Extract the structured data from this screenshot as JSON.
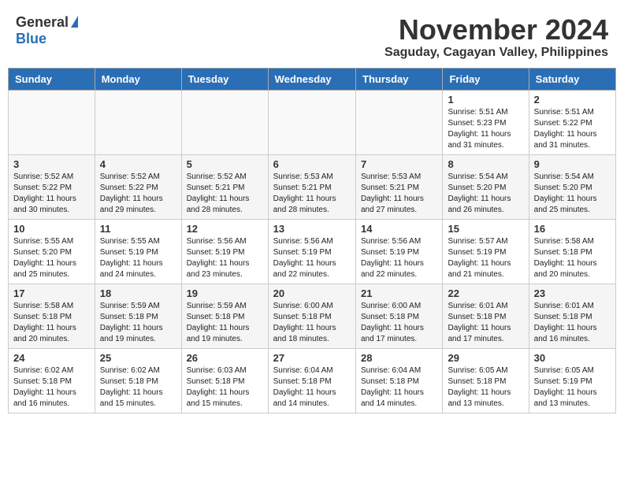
{
  "header": {
    "logo_general": "General",
    "logo_blue": "Blue",
    "month_title": "November 2024",
    "location": "Saguday, Cagayan Valley, Philippines"
  },
  "days_of_week": [
    "Sunday",
    "Monday",
    "Tuesday",
    "Wednesday",
    "Thursday",
    "Friday",
    "Saturday"
  ],
  "weeks": [
    [
      {
        "day": "",
        "info": ""
      },
      {
        "day": "",
        "info": ""
      },
      {
        "day": "",
        "info": ""
      },
      {
        "day": "",
        "info": ""
      },
      {
        "day": "",
        "info": ""
      },
      {
        "day": "1",
        "info": "Sunrise: 5:51 AM\nSunset: 5:23 PM\nDaylight: 11 hours and 31 minutes."
      },
      {
        "day": "2",
        "info": "Sunrise: 5:51 AM\nSunset: 5:22 PM\nDaylight: 11 hours and 31 minutes."
      }
    ],
    [
      {
        "day": "3",
        "info": "Sunrise: 5:52 AM\nSunset: 5:22 PM\nDaylight: 11 hours and 30 minutes."
      },
      {
        "day": "4",
        "info": "Sunrise: 5:52 AM\nSunset: 5:22 PM\nDaylight: 11 hours and 29 minutes."
      },
      {
        "day": "5",
        "info": "Sunrise: 5:52 AM\nSunset: 5:21 PM\nDaylight: 11 hours and 28 minutes."
      },
      {
        "day": "6",
        "info": "Sunrise: 5:53 AM\nSunset: 5:21 PM\nDaylight: 11 hours and 28 minutes."
      },
      {
        "day": "7",
        "info": "Sunrise: 5:53 AM\nSunset: 5:21 PM\nDaylight: 11 hours and 27 minutes."
      },
      {
        "day": "8",
        "info": "Sunrise: 5:54 AM\nSunset: 5:20 PM\nDaylight: 11 hours and 26 minutes."
      },
      {
        "day": "9",
        "info": "Sunrise: 5:54 AM\nSunset: 5:20 PM\nDaylight: 11 hours and 25 minutes."
      }
    ],
    [
      {
        "day": "10",
        "info": "Sunrise: 5:55 AM\nSunset: 5:20 PM\nDaylight: 11 hours and 25 minutes."
      },
      {
        "day": "11",
        "info": "Sunrise: 5:55 AM\nSunset: 5:19 PM\nDaylight: 11 hours and 24 minutes."
      },
      {
        "day": "12",
        "info": "Sunrise: 5:56 AM\nSunset: 5:19 PM\nDaylight: 11 hours and 23 minutes."
      },
      {
        "day": "13",
        "info": "Sunrise: 5:56 AM\nSunset: 5:19 PM\nDaylight: 11 hours and 22 minutes."
      },
      {
        "day": "14",
        "info": "Sunrise: 5:56 AM\nSunset: 5:19 PM\nDaylight: 11 hours and 22 minutes."
      },
      {
        "day": "15",
        "info": "Sunrise: 5:57 AM\nSunset: 5:19 PM\nDaylight: 11 hours and 21 minutes."
      },
      {
        "day": "16",
        "info": "Sunrise: 5:58 AM\nSunset: 5:18 PM\nDaylight: 11 hours and 20 minutes."
      }
    ],
    [
      {
        "day": "17",
        "info": "Sunrise: 5:58 AM\nSunset: 5:18 PM\nDaylight: 11 hours and 20 minutes."
      },
      {
        "day": "18",
        "info": "Sunrise: 5:59 AM\nSunset: 5:18 PM\nDaylight: 11 hours and 19 minutes."
      },
      {
        "day": "19",
        "info": "Sunrise: 5:59 AM\nSunset: 5:18 PM\nDaylight: 11 hours and 19 minutes."
      },
      {
        "day": "20",
        "info": "Sunrise: 6:00 AM\nSunset: 5:18 PM\nDaylight: 11 hours and 18 minutes."
      },
      {
        "day": "21",
        "info": "Sunrise: 6:00 AM\nSunset: 5:18 PM\nDaylight: 11 hours and 17 minutes."
      },
      {
        "day": "22",
        "info": "Sunrise: 6:01 AM\nSunset: 5:18 PM\nDaylight: 11 hours and 17 minutes."
      },
      {
        "day": "23",
        "info": "Sunrise: 6:01 AM\nSunset: 5:18 PM\nDaylight: 11 hours and 16 minutes."
      }
    ],
    [
      {
        "day": "24",
        "info": "Sunrise: 6:02 AM\nSunset: 5:18 PM\nDaylight: 11 hours and 16 minutes."
      },
      {
        "day": "25",
        "info": "Sunrise: 6:02 AM\nSunset: 5:18 PM\nDaylight: 11 hours and 15 minutes."
      },
      {
        "day": "26",
        "info": "Sunrise: 6:03 AM\nSunset: 5:18 PM\nDaylight: 11 hours and 15 minutes."
      },
      {
        "day": "27",
        "info": "Sunrise: 6:04 AM\nSunset: 5:18 PM\nDaylight: 11 hours and 14 minutes."
      },
      {
        "day": "28",
        "info": "Sunrise: 6:04 AM\nSunset: 5:18 PM\nDaylight: 11 hours and 14 minutes."
      },
      {
        "day": "29",
        "info": "Sunrise: 6:05 AM\nSunset: 5:18 PM\nDaylight: 11 hours and 13 minutes."
      },
      {
        "day": "30",
        "info": "Sunrise: 6:05 AM\nSunset: 5:19 PM\nDaylight: 11 hours and 13 minutes."
      }
    ]
  ]
}
